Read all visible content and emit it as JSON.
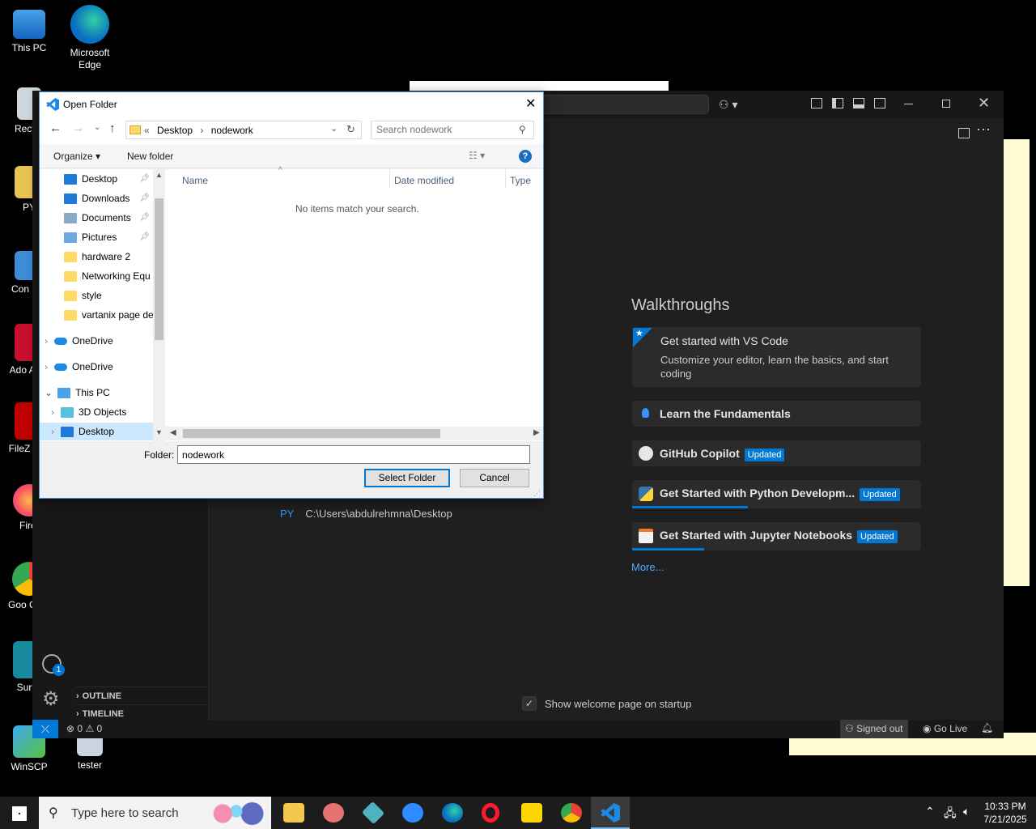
{
  "desktop": {
    "icons": [
      {
        "label": "This PC"
      },
      {
        "label": "Microsoft Edge"
      },
      {
        "label": "Recycl"
      },
      {
        "label": "PY"
      },
      {
        "label": "Con Par"
      },
      {
        "label": "Ado Acro"
      },
      {
        "label": "FileZ Clie"
      },
      {
        "label": "Firef"
      },
      {
        "label": "Goo Chro"
      },
      {
        "label": "Surfsl"
      },
      {
        "label": "WinSCP"
      },
      {
        "label": "tester"
      }
    ]
  },
  "vscode": {
    "walkthroughs_heading": "Walkthroughs",
    "cards": [
      {
        "title": "Get started with VS Code",
        "desc": "Customize your editor, learn the basics, and start coding"
      },
      {
        "title": "Learn the Fundamentals"
      },
      {
        "title": "GitHub Copilot",
        "badge": "Updated"
      },
      {
        "title": "Get Started with Python Developm...",
        "badge": "Updated",
        "progress": 0.4
      },
      {
        "title": "Get Started with Jupyter Notebooks",
        "badge": "Updated",
        "progress": 0.25
      }
    ],
    "more_link": "More...",
    "recent": {
      "tag": "PY",
      "path": "C:\\Users\\abdulrehmna\\Desktop"
    },
    "startup_checkbox": "Show welcome page on startup",
    "sidebar_sections": [
      "OUTLINE",
      "TIMELINE"
    ],
    "account_badge": "1",
    "status": {
      "errors": "0",
      "warnings": "0",
      "signed_out": "Signed out",
      "go_live": "Go Live"
    }
  },
  "dialog": {
    "title": "Open Folder",
    "breadcrumb": [
      "«",
      "Desktop",
      "›",
      "nodework"
    ],
    "search_placeholder": "Search nodework",
    "toolbar": {
      "organize": "Organize ▾",
      "new_folder": "New folder"
    },
    "nav_items": [
      {
        "label": "Desktop",
        "pinned": true,
        "color": "#1e7ad6"
      },
      {
        "label": "Downloads",
        "pinned": true,
        "color": "#1e7ad6"
      },
      {
        "label": "Documents",
        "pinned": true,
        "color": "#8aa8c8"
      },
      {
        "label": "Pictures",
        "pinned": true,
        "color": "#6fa8dc"
      },
      {
        "label": "hardware 2",
        "color": "#ffd966"
      },
      {
        "label": "Networking Equ",
        "color": "#ffd966"
      },
      {
        "label": "style",
        "color": "#ffd966"
      },
      {
        "label": "vartanix page de",
        "color": "#ffd966"
      }
    ],
    "tree_items": [
      {
        "label": "OneDrive"
      },
      {
        "label": "OneDrive"
      },
      {
        "label": "This PC"
      },
      {
        "label": "3D Objects"
      },
      {
        "label": "Desktop"
      }
    ],
    "columns": [
      "Name",
      "Date modified",
      "Type"
    ],
    "empty_message": "No items match your search.",
    "folder_label": "Folder:",
    "folder_value": "nodework",
    "select_button": "Select Folder",
    "cancel_button": "Cancel"
  },
  "taskbar": {
    "search_placeholder": "Type here to search",
    "time": "10:33 PM",
    "date": "7/21/2025"
  }
}
